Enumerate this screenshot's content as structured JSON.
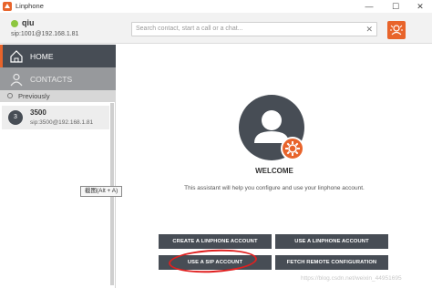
{
  "window": {
    "title": "Linphone",
    "controls": [
      "—",
      "☐",
      "✕"
    ]
  },
  "account": {
    "name": "qiu",
    "address": "sip:1001@192.168.1.81",
    "presence_color": "#8dc63f"
  },
  "search": {
    "placeholder": "Search contact, start a call or a chat...",
    "clear_symbol": "✕"
  },
  "sidebar": {
    "home_label": "HOME",
    "contacts_label": "CONTACTS",
    "previously_label": "Previously",
    "conversations": [
      {
        "avatar": "3",
        "name": "3500",
        "address": "sip:3500@192.168.1.81"
      }
    ]
  },
  "tooltip": {
    "text": "截图(Alt + A)"
  },
  "main": {
    "welcome": "WELCOME",
    "description": "This assistant will help you configure and use your linphone account.",
    "buttons": {
      "create_account": "CREATE A LINPHONE ACCOUNT",
      "use_linphone_account": "USE A LINPHONE ACCOUNT",
      "use_sip_account": "USE A SIP ACCOUNT",
      "fetch_remote_config": "FETCH REMOTE CONFIGURATION"
    }
  },
  "watermark": "https://blog.csdn.net/weixin_44951695",
  "colors": {
    "accent": "#e8642b",
    "dark": "#474d55",
    "annotation": "#e02020"
  },
  "icons": {
    "app": "linphone-logo-icon",
    "home": "home-icon",
    "contacts": "person-icon",
    "call": "call-icon",
    "gear": "gear-icon"
  }
}
